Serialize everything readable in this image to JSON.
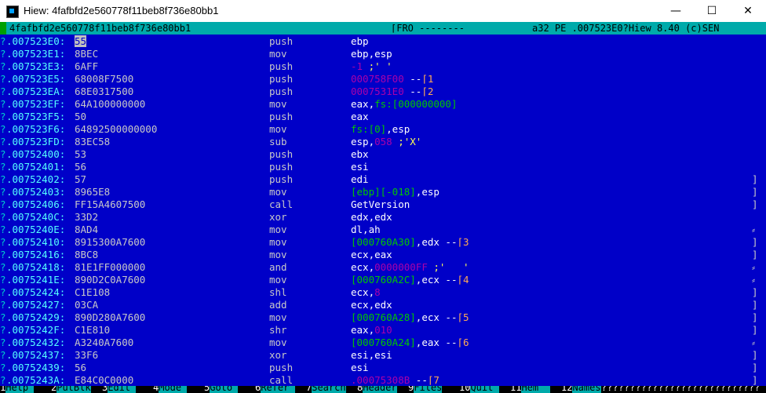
{
  "window": {
    "title": "Hiew: 4fafbfd2e560778f11beb8f736e80bb1",
    "min": "—",
    "max": "☐",
    "close": "✕"
  },
  "status": {
    "filename": "4fafbfd2e560778f11beb8f736e80bb1",
    "mode": "⌈FRO --------",
    "info": "a32 PE .007523E0?Hiew 8.40 (c)SEN"
  },
  "rows": [
    {
      "addr": ".007523E0:",
      "bytes": "55",
      "mn": "push",
      "op": [
        [
          "ebp",
          "reg"
        ]
      ],
      "sb": ""
    },
    {
      "addr": ".007523E1:",
      "bytes": "8BEC",
      "mn": "mov",
      "op": [
        [
          "ebp,esp",
          "reg"
        ]
      ],
      "sb": ""
    },
    {
      "addr": ".007523E3:",
      "bytes": "6AFF",
      "mn": "push",
      "op": [
        [
          "-1",
          "num"
        ],
        [
          " ;' '",
          "cmt"
        ]
      ],
      "sb": ""
    },
    {
      "addr": ".007523E5:",
      "bytes": "68008F7500",
      "mn": "push",
      "op": [
        [
          "000758F00",
          "num"
        ],
        [
          " --",
          "sym"
        ],
        [
          "⌈1",
          "ref"
        ]
      ],
      "sb": ""
    },
    {
      "addr": ".007523EA:",
      "bytes": "68E0317500",
      "mn": "push",
      "op": [
        [
          "0007531E0",
          "num"
        ],
        [
          " --",
          "sym"
        ],
        [
          "⌈2",
          "ref"
        ]
      ],
      "sb": ""
    },
    {
      "addr": ".007523EF:",
      "bytes": "64A100000000",
      "mn": "mov",
      "op": [
        [
          "eax,",
          "reg"
        ],
        [
          "fs:[000000000]",
          "mem"
        ]
      ],
      "sb": ""
    },
    {
      "addr": ".007523F5:",
      "bytes": "50",
      "mn": "push",
      "op": [
        [
          "eax",
          "reg"
        ]
      ],
      "sb": ""
    },
    {
      "addr": ".007523F6:",
      "bytes": "64892500000000",
      "mn": "mov",
      "op": [
        [
          "fs:[0]",
          "mem"
        ],
        [
          ",esp",
          "reg"
        ]
      ],
      "sb": ""
    },
    {
      "addr": ".007523FD:",
      "bytes": "83EC58",
      "mn": "sub",
      "op": [
        [
          "esp,",
          "reg"
        ],
        [
          "058",
          "num"
        ],
        [
          " ;'X'",
          "cmt"
        ]
      ],
      "sb": ""
    },
    {
      "addr": ".00752400:",
      "bytes": "53",
      "mn": "push",
      "op": [
        [
          "ebx",
          "reg"
        ]
      ],
      "sb": ""
    },
    {
      "addr": ".00752401:",
      "bytes": "56",
      "mn": "push",
      "op": [
        [
          "esi",
          "reg"
        ]
      ],
      "sb": ""
    },
    {
      "addr": ".00752402:",
      "bytes": "57",
      "mn": "push",
      "op": [
        [
          "edi",
          "reg"
        ]
      ],
      "sb": "]"
    },
    {
      "addr": ".00752403:",
      "bytes": "8965E8",
      "mn": "mov",
      "op": [
        [
          "[ebp][-018]",
          "mem"
        ],
        [
          ",esp",
          "reg"
        ]
      ],
      "sb": "]"
    },
    {
      "addr": ".00752406:",
      "bytes": "FF15A4607500",
      "mn": "call",
      "op": [
        [
          "GetVersion",
          "sym"
        ]
      ],
      "sb": "]"
    },
    {
      "addr": ".0075240C:",
      "bytes": "33D2",
      "mn": "xor",
      "op": [
        [
          "edx,edx",
          "reg"
        ]
      ],
      "sb": ""
    },
    {
      "addr": ".0075240E:",
      "bytes": "8AD4",
      "mn": "mov",
      "op": [
        [
          "dl,ah",
          "reg"
        ]
      ],
      "sb": "⸗"
    },
    {
      "addr": ".00752410:",
      "bytes": "8915300A7600",
      "mn": "mov",
      "op": [
        [
          "[000760A30]",
          "mem"
        ],
        [
          ",edx --",
          "reg"
        ],
        [
          "⌈3",
          "ref"
        ]
      ],
      "sb": "]"
    },
    {
      "addr": ".00752416:",
      "bytes": "8BC8",
      "mn": "mov",
      "op": [
        [
          "ecx,eax",
          "reg"
        ]
      ],
      "sb": "]"
    },
    {
      "addr": ".00752418:",
      "bytes": "81E1FF000000",
      "mn": "and",
      "op": [
        [
          "ecx,",
          "reg"
        ],
        [
          "0000000FF",
          "num"
        ],
        [
          " ;'   '",
          "cmt"
        ]
      ],
      "sb": "⸗"
    },
    {
      "addr": ".0075241E:",
      "bytes": "890D2C0A7600",
      "mn": "mov",
      "op": [
        [
          "[000760A2C]",
          "mem"
        ],
        [
          ",ecx --",
          "reg"
        ],
        [
          "⌈4",
          "ref"
        ]
      ],
      "sb": "⸗"
    },
    {
      "addr": ".00752424:",
      "bytes": "C1E108",
      "mn": "shl",
      "op": [
        [
          "ecx,",
          "reg"
        ],
        [
          "8",
          "num"
        ]
      ],
      "sb": "]"
    },
    {
      "addr": ".00752427:",
      "bytes": "03CA",
      "mn": "add",
      "op": [
        [
          "ecx,edx",
          "reg"
        ]
      ],
      "sb": "]"
    },
    {
      "addr": ".00752429:",
      "bytes": "890D280A7600",
      "mn": "mov",
      "op": [
        [
          "[000760A28]",
          "mem"
        ],
        [
          ",ecx --",
          "reg"
        ],
        [
          "⌈5",
          "ref"
        ]
      ],
      "sb": "]"
    },
    {
      "addr": ".0075242F:",
      "bytes": "C1E810",
      "mn": "shr",
      "op": [
        [
          "eax,",
          "reg"
        ],
        [
          "010",
          "num"
        ]
      ],
      "sb": "]"
    },
    {
      "addr": ".00752432:",
      "bytes": "A3240A7600",
      "mn": "mov",
      "op": [
        [
          "[000760A24]",
          "mem"
        ],
        [
          ",eax --",
          "reg"
        ],
        [
          "⌈6",
          "ref"
        ]
      ],
      "sb": "⸗"
    },
    {
      "addr": ".00752437:",
      "bytes": "33F6",
      "mn": "xor",
      "op": [
        [
          "esi,esi",
          "reg"
        ]
      ],
      "sb": "]"
    },
    {
      "addr": ".00752439:",
      "bytes": "56",
      "mn": "push",
      "op": [
        [
          "esi",
          "reg"
        ]
      ],
      "sb": "]"
    },
    {
      "addr": ".0075243A:",
      "bytes": "E84C0C0000",
      "mn": "call",
      "op": [
        [
          ".00075308B",
          "num"
        ],
        [
          " --",
          "sym"
        ],
        [
          "⌈7",
          "ref"
        ]
      ],
      "sb": "]"
    }
  ],
  "fkeys": [
    {
      "n": "1",
      "label": "Help "
    },
    {
      "n": "2",
      "label": "PutBlk"
    },
    {
      "n": "3",
      "label": "Edit "
    },
    {
      "n": "4",
      "label": "Mode "
    },
    {
      "n": "5",
      "label": "Goto "
    },
    {
      "n": "6",
      "label": "Refer "
    },
    {
      "n": "7",
      "label": "Search"
    },
    {
      "n": "8",
      "label": "Header"
    },
    {
      "n": "9",
      "label": "Files"
    },
    {
      "n": "10",
      "label": "Quit "
    },
    {
      "n": "11",
      "label": "Hem  "
    },
    {
      "n": "12",
      "label": "Names"
    }
  ],
  "fkeys_tail": "????????????????????????????",
  "colors": {
    "background": "#0000c8",
    "status_bar": "#00aaaa",
    "address": "#55ffff",
    "memory": "#00c800",
    "number": "#aa00aa",
    "reference": "#ffaa55"
  }
}
